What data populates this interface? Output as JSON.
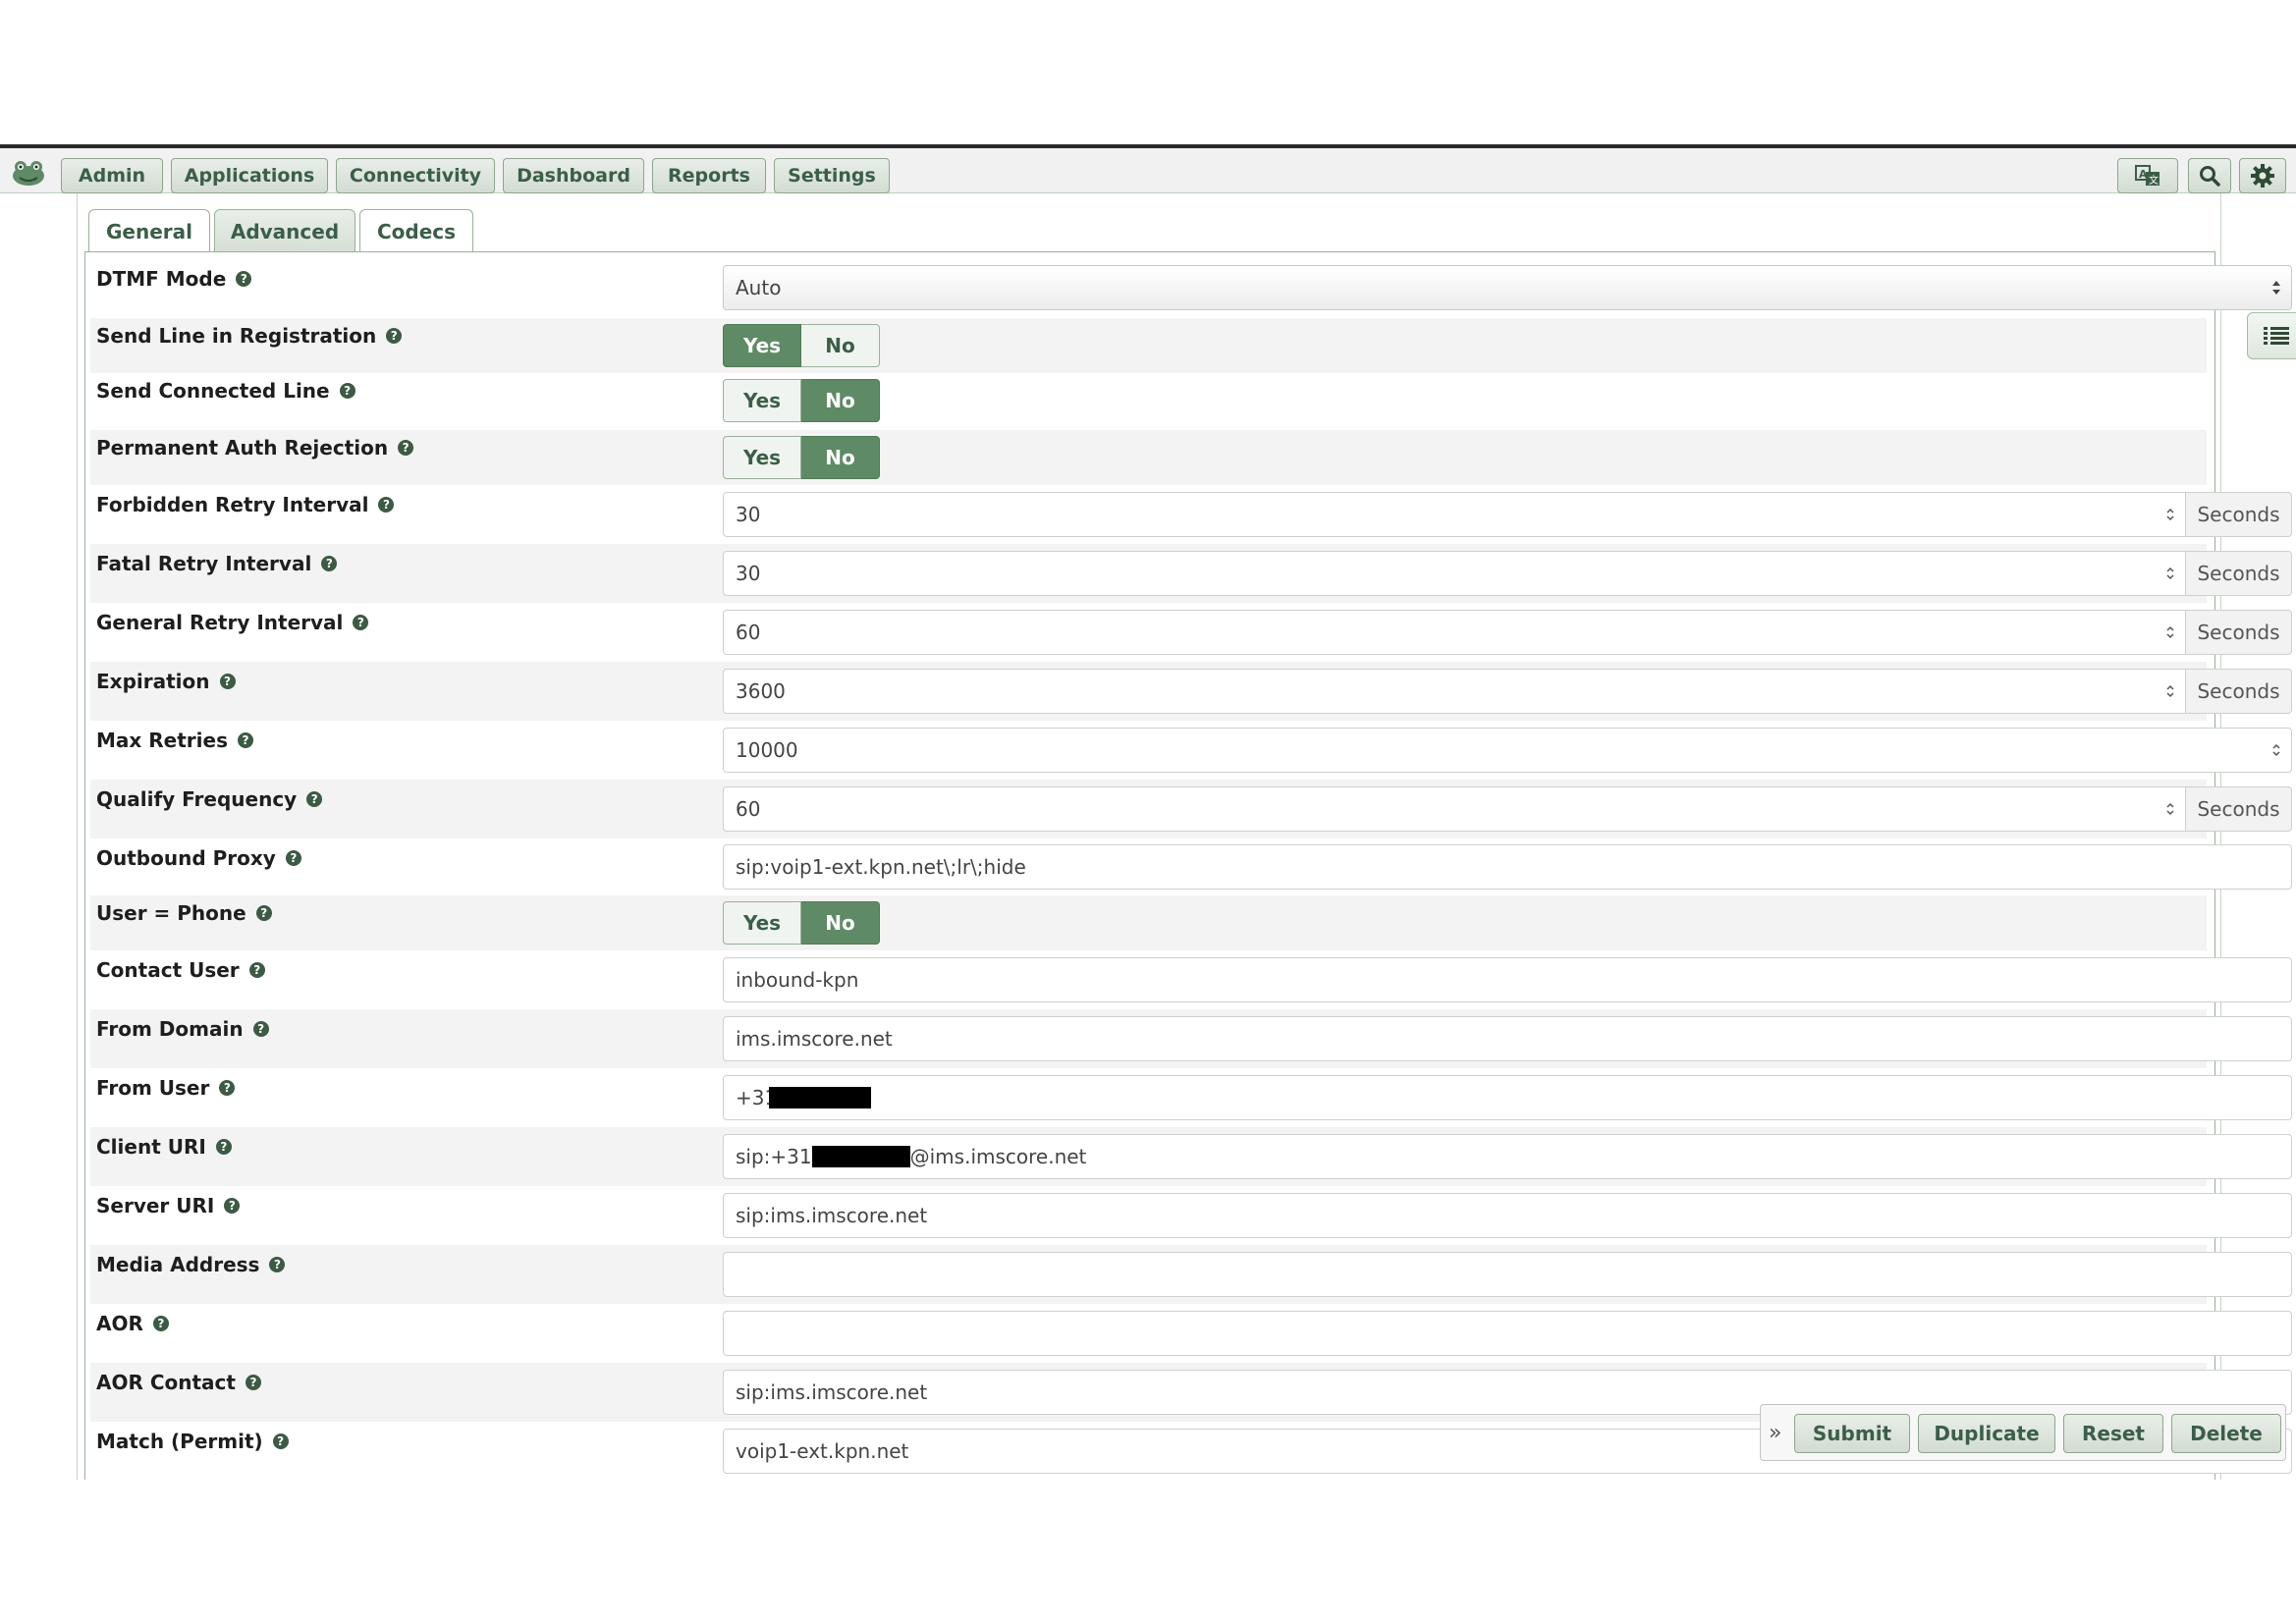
{
  "menu": {
    "items": [
      "Admin",
      "Applications",
      "Connectivity",
      "Dashboard",
      "Reports",
      "Settings"
    ]
  },
  "top_icons": [
    "translate-icon",
    "search-icon",
    "gear-icon"
  ],
  "tabs": [
    {
      "label": "General",
      "active": false
    },
    {
      "label": "Advanced",
      "active": true
    },
    {
      "label": "Codecs",
      "active": false
    }
  ],
  "toggle_labels": {
    "yes": "Yes",
    "no": "No"
  },
  "fields": {
    "dtmf_mode": {
      "label": "DTMF Mode",
      "value": "Auto"
    },
    "send_line_in_registration": {
      "label": "Send Line in Registration",
      "value": "Yes"
    },
    "send_connected_line": {
      "label": "Send Connected Line",
      "value": "No"
    },
    "permanent_auth_rejection": {
      "label": "Permanent Auth Rejection",
      "value": "No"
    },
    "forbidden_retry_interval": {
      "label": "Forbidden Retry Interval",
      "value": "30",
      "unit": "Seconds"
    },
    "fatal_retry_interval": {
      "label": "Fatal Retry Interval",
      "value": "30",
      "unit": "Seconds"
    },
    "general_retry_interval": {
      "label": "General Retry Interval",
      "value": "60",
      "unit": "Seconds"
    },
    "expiration": {
      "label": "Expiration",
      "value": "3600",
      "unit": "Seconds"
    },
    "max_retries": {
      "label": "Max Retries",
      "value": "10000"
    },
    "qualify_frequency": {
      "label": "Qualify Frequency",
      "value": "60",
      "unit": "Seconds"
    },
    "outbound_proxy": {
      "label": "Outbound Proxy",
      "value": "sip:voip1-ext.kpn.net\\;lr\\;hide"
    },
    "user_phone": {
      "label": "User = Phone",
      "value": "No"
    },
    "contact_user": {
      "label": "Contact User",
      "value": "inbound-kpn"
    },
    "from_domain": {
      "label": "From Domain",
      "value": "ims.imscore.net"
    },
    "from_user": {
      "label": "From User",
      "value_prefix": "+31"
    },
    "client_uri": {
      "label": "Client URI",
      "value_prefix": "sip:+31",
      "value_suffix": "@ims.imscore.net"
    },
    "server_uri": {
      "label": "Server URI",
      "value": "sip:ims.imscore.net"
    },
    "media_address": {
      "label": "Media Address",
      "value": ""
    },
    "aor": {
      "label": "AOR",
      "value": ""
    },
    "aor_contact": {
      "label": "AOR Contact",
      "value": "sip:ims.imscore.net"
    },
    "match_permit": {
      "label": "Match (Permit)",
      "value": "voip1-ext.kpn.net"
    }
  },
  "actions": {
    "collapse": "»",
    "submit": "Submit",
    "duplicate": "Duplicate",
    "reset": "Reset",
    "delete": "Delete"
  },
  "colors": {
    "accent": "#5f8a66",
    "button_text": "#3c5e48",
    "help_icon": "#3c5a44"
  }
}
